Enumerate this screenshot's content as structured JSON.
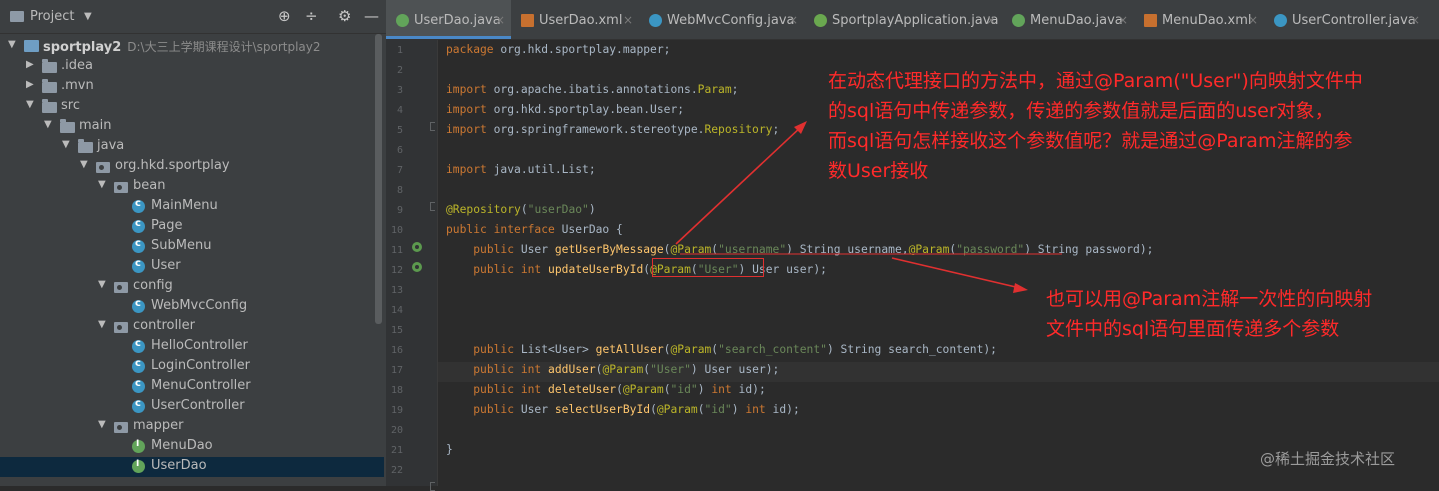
{
  "project_panel": {
    "title": "Project",
    "tools": [
      "target-icon",
      "collapse-icon",
      "gear-icon",
      "minimize-icon"
    ],
    "tree": [
      {
        "label": "sportplay2",
        "path": "D:\\大三上学期课程设计\\sportplay2",
        "icon": "project",
        "depth": 0,
        "arrow": "▼"
      },
      {
        "label": ".idea",
        "icon": "folder",
        "depth": 1,
        "arrow": "▶"
      },
      {
        "label": ".mvn",
        "icon": "folder",
        "depth": 1,
        "arrow": "▶"
      },
      {
        "label": "src",
        "icon": "folder",
        "depth": 1,
        "arrow": "▼"
      },
      {
        "label": "main",
        "icon": "folder",
        "depth": 2,
        "arrow": "▼"
      },
      {
        "label": "java",
        "icon": "folder",
        "depth": 3,
        "arrow": "▼"
      },
      {
        "label": "org.hkd.sportplay",
        "icon": "package",
        "depth": 4,
        "arrow": "▼"
      },
      {
        "label": "bean",
        "icon": "package",
        "depth": 5,
        "arrow": "▼"
      },
      {
        "label": "MainMenu",
        "icon": "class",
        "depth": 6,
        "arrow": ""
      },
      {
        "label": "Page",
        "icon": "class",
        "depth": 6,
        "arrow": ""
      },
      {
        "label": "SubMenu",
        "icon": "class",
        "depth": 6,
        "arrow": ""
      },
      {
        "label": "User",
        "icon": "class",
        "depth": 6,
        "arrow": ""
      },
      {
        "label": "config",
        "icon": "package",
        "depth": 5,
        "arrow": "▼"
      },
      {
        "label": "WebMvcConfig",
        "icon": "class",
        "depth": 6,
        "arrow": ""
      },
      {
        "label": "controller",
        "icon": "package",
        "depth": 5,
        "arrow": "▼"
      },
      {
        "label": "HelloController",
        "icon": "class",
        "depth": 6,
        "arrow": ""
      },
      {
        "label": "LoginController",
        "icon": "class",
        "depth": 6,
        "arrow": ""
      },
      {
        "label": "MenuController",
        "icon": "class",
        "depth": 6,
        "arrow": ""
      },
      {
        "label": "UserController",
        "icon": "class",
        "depth": 6,
        "arrow": ""
      },
      {
        "label": "mapper",
        "icon": "package",
        "depth": 5,
        "arrow": "▼"
      },
      {
        "label": "MenuDao",
        "icon": "interface",
        "depth": 6,
        "arrow": ""
      },
      {
        "label": "UserDao",
        "icon": "interface",
        "depth": 6,
        "arrow": "",
        "selected": true
      }
    ]
  },
  "tabs": [
    {
      "label": "UserDao.java",
      "icon": "interface",
      "active": true
    },
    {
      "label": "UserDao.xml",
      "icon": "xml"
    },
    {
      "label": "WebMvcConfig.java",
      "icon": "class"
    },
    {
      "label": "SportplayApplication.java",
      "icon": "spring"
    },
    {
      "label": "MenuDao.java",
      "icon": "interface"
    },
    {
      "label": "MenuDao.xml",
      "icon": "xml"
    },
    {
      "label": "UserController.java",
      "icon": "class"
    }
  ],
  "colors": {
    "annotation_red": "#ff2a2a",
    "keyword": "#cc7832",
    "string": "#6a8759",
    "method": "#ffc66d",
    "annotation": "#bbb529"
  },
  "code": [
    {
      "n": "1",
      "tokens": [
        [
          "kw",
          "package "
        ],
        [
          "t",
          "org.hkd.sportplay.mapper;"
        ]
      ]
    },
    {
      "n": "2",
      "tokens": []
    },
    {
      "n": "3",
      "tokens": [
        [
          "kw",
          "import "
        ],
        [
          "t",
          "org.apache.ibatis.annotations."
        ],
        [
          "ann",
          "Param"
        ],
        [
          "t",
          ";"
        ]
      ]
    },
    {
      "n": "4",
      "tokens": [
        [
          "kw",
          "import "
        ],
        [
          "t",
          "org.hkd.sportplay.bean.User;"
        ]
      ]
    },
    {
      "n": "5",
      "tokens": [
        [
          "kw",
          "import "
        ],
        [
          "t",
          "org.springframework.stereotype."
        ],
        [
          "ann",
          "Repository"
        ],
        [
          "t",
          ";"
        ]
      ]
    },
    {
      "n": "6",
      "tokens": []
    },
    {
      "n": "7",
      "tokens": [
        [
          "kw",
          "import "
        ],
        [
          "t",
          "java.util.List;"
        ]
      ]
    },
    {
      "n": "8",
      "tokens": []
    },
    {
      "n": "9",
      "tokens": [
        [
          "ann",
          "@Repository"
        ],
        [
          "t",
          "("
        ],
        [
          "str",
          "\"userDao\""
        ],
        [
          "t",
          ")"
        ]
      ]
    },
    {
      "n": "10",
      "tokens": [
        [
          "kw",
          "public interface "
        ],
        [
          "t",
          "UserDao {"
        ]
      ]
    },
    {
      "n": "11",
      "tokens": [
        [
          "t",
          "    "
        ],
        [
          "kw",
          "public "
        ],
        [
          "t",
          "User "
        ],
        [
          "fn",
          "getUserByMessage"
        ],
        [
          "t",
          "("
        ],
        [
          "ann",
          "@Param"
        ],
        [
          "t",
          "("
        ],
        [
          "str",
          "\"username\""
        ],
        [
          "t",
          ") String username,"
        ],
        [
          "ann",
          "@Param"
        ],
        [
          "t",
          "("
        ],
        [
          "str",
          "\"password\""
        ],
        [
          "t",
          ") String password);"
        ]
      ]
    },
    {
      "n": "12",
      "tokens": [
        [
          "t",
          "    "
        ],
        [
          "kw",
          "public int "
        ],
        [
          "fn",
          "updateUserById"
        ],
        [
          "t",
          "("
        ],
        [
          "ann",
          "@Param"
        ],
        [
          "t",
          "("
        ],
        [
          "str",
          "\"User\""
        ],
        [
          "t",
          ") User user);"
        ]
      ]
    },
    {
      "n": "13",
      "tokens": []
    },
    {
      "n": "14",
      "tokens": []
    },
    {
      "n": "15",
      "tokens": []
    },
    {
      "n": "16",
      "tokens": [
        [
          "t",
          "    "
        ],
        [
          "kw",
          "public "
        ],
        [
          "t",
          "List<User> "
        ],
        [
          "fn",
          "getAllUser"
        ],
        [
          "t",
          "("
        ],
        [
          "ann",
          "@Param"
        ],
        [
          "t",
          "("
        ],
        [
          "str",
          "\"search_content\""
        ],
        [
          "t",
          ") String search_content);"
        ]
      ]
    },
    {
      "n": "17",
      "tokens": [
        [
          "t",
          "    "
        ],
        [
          "kw",
          "public int "
        ],
        [
          "fn",
          "addUser"
        ],
        [
          "t",
          "("
        ],
        [
          "ann",
          "@Param"
        ],
        [
          "t",
          "("
        ],
        [
          "str",
          "\"User\""
        ],
        [
          "t",
          ") User user);"
        ]
      ]
    },
    {
      "n": "18",
      "tokens": [
        [
          "t",
          "    "
        ],
        [
          "kw",
          "public int "
        ],
        [
          "fn",
          "deleteUser"
        ],
        [
          "t",
          "("
        ],
        [
          "ann",
          "@Param"
        ],
        [
          "t",
          "("
        ],
        [
          "str",
          "\"id\""
        ],
        [
          "t",
          ") "
        ],
        [
          "kw",
          "int "
        ],
        [
          "t",
          "id);"
        ]
      ]
    },
    {
      "n": "19",
      "tokens": [
        [
          "t",
          "    "
        ],
        [
          "kw",
          "public "
        ],
        [
          "t",
          "User "
        ],
        [
          "fn",
          "selectUserById"
        ],
        [
          "t",
          "("
        ],
        [
          "ann",
          "@Param"
        ],
        [
          "t",
          "("
        ],
        [
          "str",
          "\"id\""
        ],
        [
          "t",
          ") "
        ],
        [
          "kw",
          "int "
        ],
        [
          "t",
          "id);"
        ]
      ]
    },
    {
      "n": "20",
      "tokens": []
    },
    {
      "n": "21",
      "tokens": [
        [
          "t",
          "}"
        ]
      ]
    },
    {
      "n": "22",
      "tokens": []
    }
  ],
  "annotations": {
    "note1": [
      "在动态代理接口的方法中，通过@Param(\"User\")向映射文件中",
      "的sql语句中传递参数，传递的参数值就是后面的user对象，",
      "而sql语句怎样接收这个参数值呢？就是通过@Param注解的参",
      "数User接收"
    ],
    "note2": [
      "也可以用@Param注解一次性的向映射",
      "文件中的sql语句里面传递多个参数"
    ]
  },
  "watermark": "@稀土掘金技术社区"
}
